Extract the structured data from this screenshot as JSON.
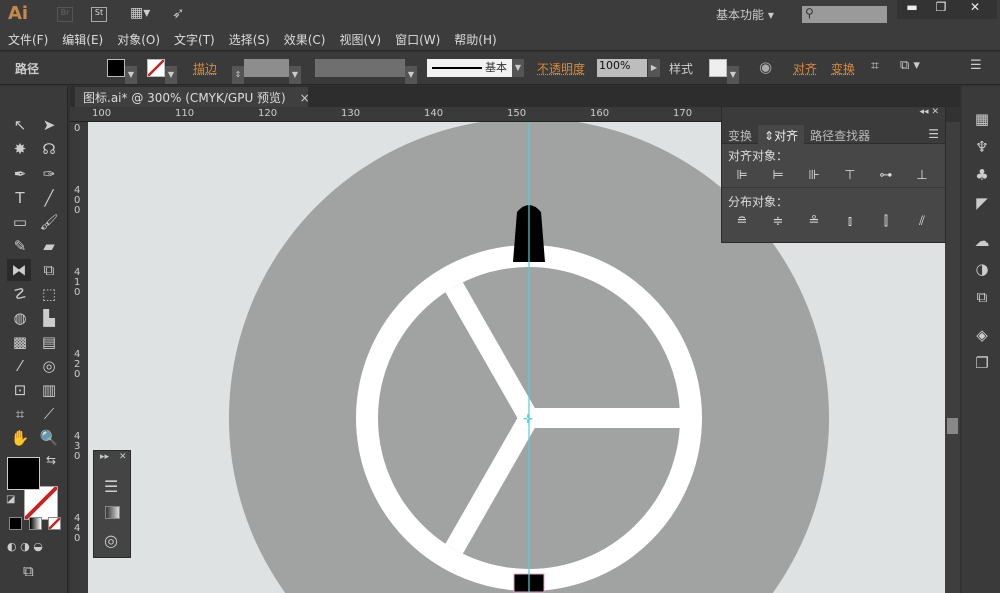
{
  "app": {
    "logo": "Ai",
    "br": "Br",
    "st": "St",
    "workspace": "基本功能",
    "search_placeholder": ""
  },
  "menu": [
    "文件(F)",
    "编辑(E)",
    "对象(O)",
    "文字(T)",
    "选择(S)",
    "效果(C)",
    "视图(V)",
    "窗口(W)",
    "帮助(H)"
  ],
  "control": {
    "selection": "路径",
    "stroke_label": "描边",
    "stroke_style": "基本",
    "opacity_label": "不透明度",
    "opacity": "100%",
    "style_label": "样式",
    "align": "对齐",
    "transform": "变换"
  },
  "doc": {
    "tab": "图标.ai* @ 300% (CMYK/GPU 预览)",
    "close": "×"
  },
  "ruler": {
    "top": [
      "100",
      "110",
      "120",
      "130",
      "140",
      "150",
      "160",
      "170"
    ],
    "left": [
      "0",
      "400",
      "410",
      "420",
      "430",
      "440"
    ]
  },
  "align_panel": {
    "tabs": [
      "变换",
      "对齐",
      "路径查找器"
    ],
    "align_objects": "对齐对象：",
    "distribute_objects": "分布对象："
  },
  "colors": {
    "accent": "#d98a3a",
    "guide": "#4fd0d8",
    "artboard": "#dfe2e2",
    "circle": "#a0a3a2"
  }
}
